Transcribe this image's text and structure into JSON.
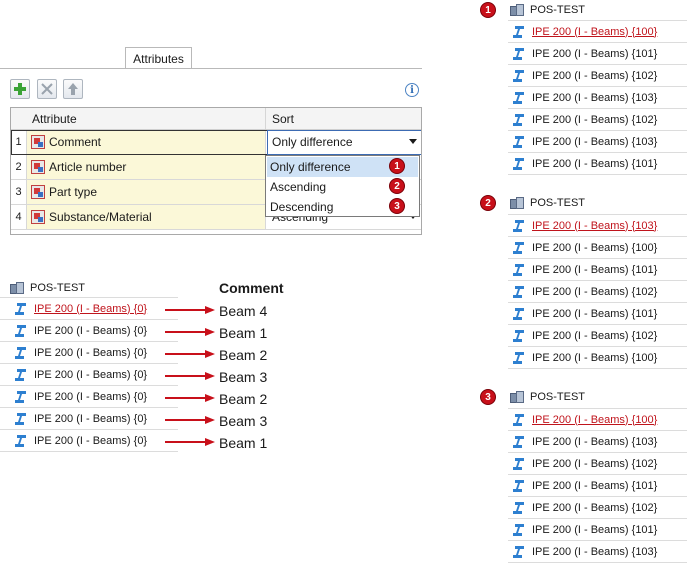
{
  "attributes_tab": {
    "label": "Attributes"
  },
  "toolbar": {
    "add_title": "Add",
    "delete_title": "Delete",
    "move_up_title": "Move up",
    "info_label": "i"
  },
  "grid": {
    "columns": [
      "Attribute",
      "Sort"
    ],
    "rows": [
      {
        "num": "1",
        "attribute": "Comment",
        "sort": "Only difference"
      },
      {
        "num": "2",
        "attribute": "Article number",
        "sort": ""
      },
      {
        "num": "3",
        "attribute": "Part type",
        "sort": ""
      },
      {
        "num": "4",
        "attribute": "Substance/Material",
        "sort": "Ascending"
      }
    ]
  },
  "sort_dropdown": {
    "options": [
      {
        "label": "Only difference",
        "badge": "1"
      },
      {
        "label": "Ascending",
        "badge": "2"
      },
      {
        "label": "Descending",
        "badge": "3"
      }
    ]
  },
  "left_tree": {
    "title": "POS-TEST",
    "items": [
      "IPE 200 (I - Beams) {0}",
      "IPE 200 (I - Beams) {0}",
      "IPE 200 (I - Beams) {0}",
      "IPE 200 (I - Beams) {0}",
      "IPE 200 (I - Beams) {0}",
      "IPE 200 (I - Beams) {0}",
      "IPE 200 (I - Beams) {0}"
    ],
    "comment_header": "Comment",
    "comments": [
      "Beam 4",
      "Beam 1",
      "Beam 2",
      "Beam 3",
      "Beam 2",
      "Beam 3",
      "Beam 1"
    ]
  },
  "tree_1": {
    "badge": "1",
    "title": "POS-TEST",
    "items": [
      "IPE 200 (I - Beams) {100}",
      "IPE 200 (I - Beams) {101}",
      "IPE 200 (I - Beams) {102}",
      "IPE 200 (I - Beams) {103}",
      "IPE 200 (I - Beams) {102}",
      "IPE 200 (I - Beams) {103}",
      "IPE 200 (I - Beams) {101}"
    ]
  },
  "tree_2": {
    "badge": "2",
    "title": "POS-TEST",
    "items": [
      "IPE 200 (I - Beams) {103}",
      "IPE 200 (I - Beams) {100}",
      "IPE 200 (I - Beams) {101}",
      "IPE 200 (I - Beams) {102}",
      "IPE 200 (I - Beams) {101}",
      "IPE 200 (I - Beams) {102}",
      "IPE 200 (I - Beams) {100}"
    ]
  },
  "tree_3": {
    "badge": "3",
    "title": "POS-TEST",
    "items": [
      "IPE 200 (I - Beams) {100}",
      "IPE 200 (I - Beams) {103}",
      "IPE 200 (I - Beams) {102}",
      "IPE 200 (I - Beams) {101}",
      "IPE 200 (I - Beams) {102}",
      "IPE 200 (I - Beams) {101}",
      "IPE 200 (I - Beams) {103}"
    ]
  },
  "colors": {
    "accent_red": "#c8101a",
    "selection_blue": "#cfe2f6",
    "attribute_cell": "#fbf8d8",
    "beam_icon": "#2d7fd0"
  },
  "icons": [
    "add-icon",
    "delete-icon",
    "move-up-icon",
    "info-icon",
    "attribute-icon",
    "position-group-icon",
    "i-beam-icon",
    "dropdown-arrow-icon",
    "red-arrow-icon"
  ]
}
